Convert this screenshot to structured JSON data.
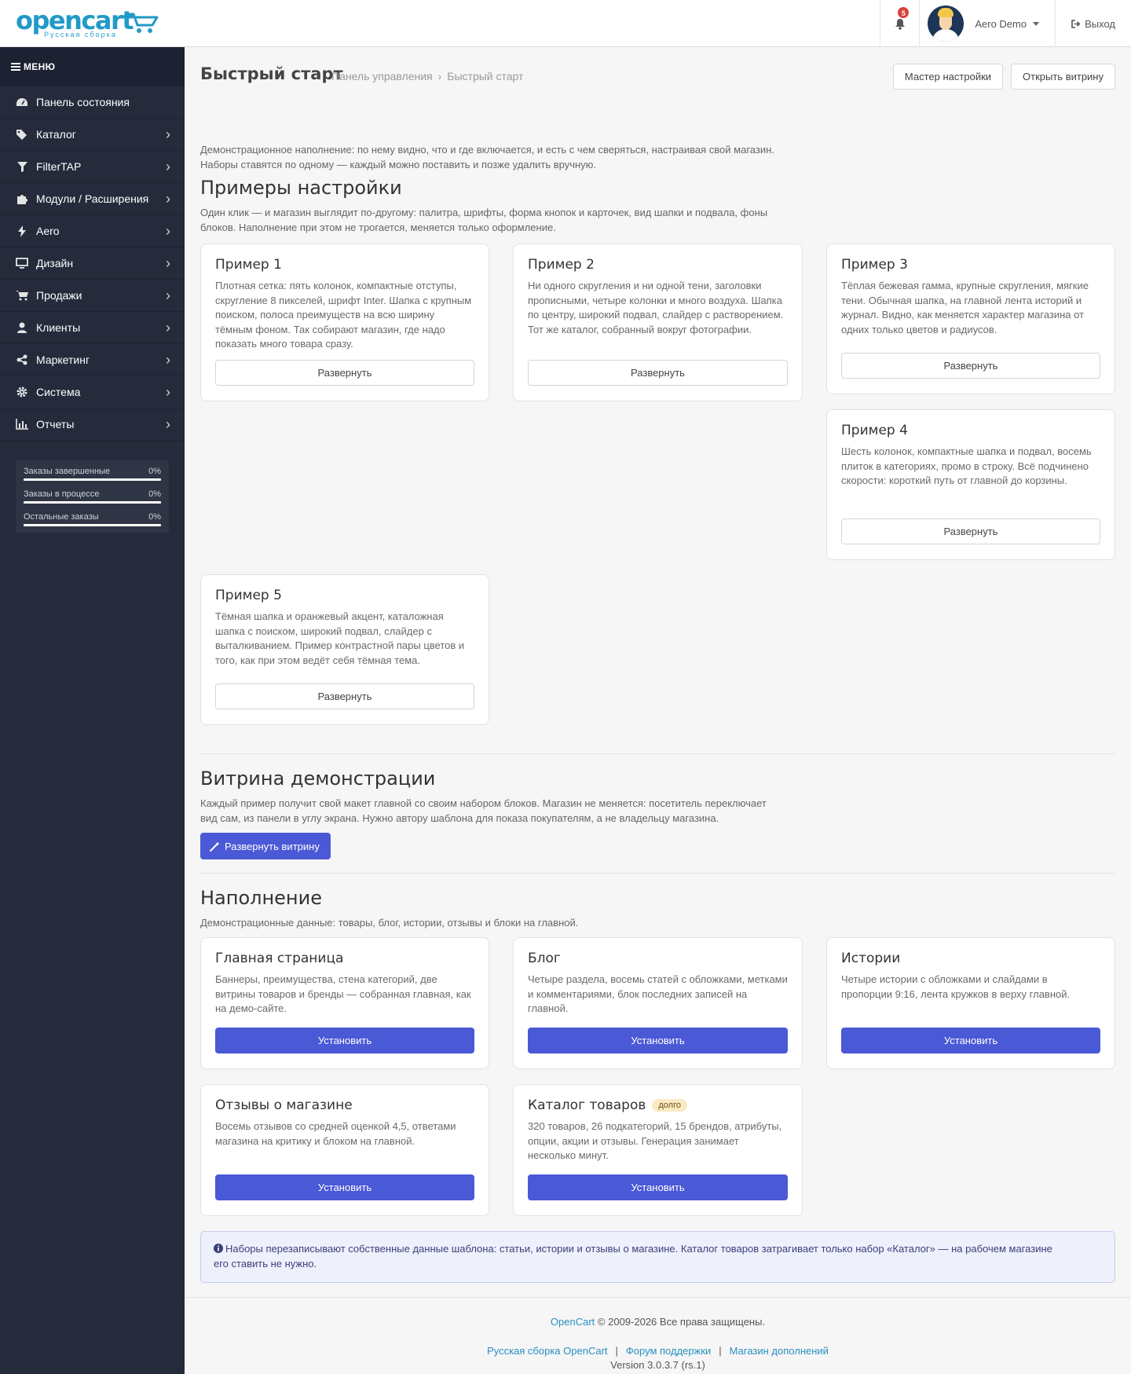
{
  "logo": {
    "main": "opencart",
    "sub": "Русская сборка"
  },
  "header": {
    "notifications_count": "5",
    "user_name": "Aero Demo",
    "logout_label": "Выход"
  },
  "sidebar": {
    "menu_title": "МЕНЮ",
    "items": [
      {
        "label": "Панель состояния",
        "icon": "dashboard-icon",
        "has_children": false
      },
      {
        "label": "Каталог",
        "icon": "tags-icon",
        "has_children": true
      },
      {
        "label": "FilterTAP",
        "icon": "filter-icon",
        "has_children": true
      },
      {
        "label": "Модули / Расширения",
        "icon": "puzzle-icon",
        "has_children": true
      },
      {
        "label": "Aero",
        "icon": "bolt-icon",
        "has_children": true
      },
      {
        "label": "Дизайн",
        "icon": "monitor-icon",
        "has_children": true
      },
      {
        "label": "Продажи",
        "icon": "cart-icon",
        "has_children": true
      },
      {
        "label": "Клиенты",
        "icon": "user-icon",
        "has_children": true
      },
      {
        "label": "Маркетинг",
        "icon": "share-icon",
        "has_children": true
      },
      {
        "label": "Система",
        "icon": "gear-icon",
        "has_children": true
      },
      {
        "label": "Отчеты",
        "icon": "bar-chart-icon",
        "has_children": true
      }
    ],
    "stats": [
      {
        "label": "Заказы завершенные",
        "value": "0%"
      },
      {
        "label": "Заказы в процессе",
        "value": "0%"
      },
      {
        "label": "Остальные заказы",
        "value": "0%"
      }
    ]
  },
  "page": {
    "title": "Быстрый старт",
    "breadcrumb": [
      "Панель управления",
      "Быстрый старт"
    ],
    "buttons": {
      "wizard": "Мастер настройки",
      "open_store": "Открыть витрину"
    },
    "intro_line1": "Демонстрационное наполнение: по нему видно, что и где включается, и есть с чем сверяться, настраивая свой магазин.",
    "intro_line2": "Наборы ставятся по одному — каждый можно поставить и позже удалить вручную."
  },
  "examples": {
    "title": "Примеры настройки",
    "desc_line1": "Один клик — и магазин выглядит по-другому: палитра, шрифты, форма кнопок и карточек, вид шапки и подвала, фоны",
    "desc_line2": "блоков. Наполнение при этом не трогается, меняется только оформление.",
    "button_label": "Развернуть",
    "items": [
      {
        "title": "Пример 1",
        "text": "Плотная сетка: пять колонок, компактные отступы, скругление 8 пикселей, шрифт Inter. Шапка с крупным поиском, полоса преимуществ на всю ширину тёмным фоном. Так собирают магазин, где надо показать много товара сразу."
      },
      {
        "title": "Пример 2",
        "text": "Ни одного скругления и ни одной тени, заголовки прописными, четыре колонки и много воздуха. Шапка по центру, широкий подвал, слайдер с растворением. Тот же каталог, собранный вокруг фотографии."
      },
      {
        "title": "Пример 3",
        "text": "Тёплая бежевая гамма, крупные скругления, мягкие тени. Обычная шапка, на главной лента историй и журнал. Видно, как меняется характер магазина от одних только цветов и радиусов."
      },
      {
        "title": "Пример 4",
        "text": "Шесть колонок, компактные шапка и подвал, восемь плиток в категориях, промо в строку. Всё подчинено скорости: короткий путь от главной до корзины."
      },
      {
        "title": "Пример 5",
        "text": "Тёмная шапка и оранжевый акцент, каталожная шапка с поиском, широкий подвал, слайдер с выталкиванием. Пример контрастной пары цветов и того, как при этом ведёт себя тёмная тема."
      }
    ]
  },
  "showcase": {
    "title": "Витрина демонстрации",
    "desc_line1": "Каждый пример получит свой макет главной со своим набором блоков. Магазин не меняется: посетитель переключает",
    "desc_line2": "вид сам, из панели в углу экрана. Нужно автору шаблона для показа покупателям, а не владельцу магазина.",
    "button_label": "Развернуть витрину"
  },
  "content_sets": {
    "title": "Наполнение",
    "desc": "Демонстрационные данные: товары, блог, истории, отзывы и блоки на главной.",
    "button_label": "Установить",
    "items": [
      {
        "title": "Главная страница",
        "text": "Баннеры, преимущества, стена категорий, две витрины товаров и бренды — собранная главная, как на демо-сайте."
      },
      {
        "title": "Блог",
        "text": "Четыре раздела, восемь статей с обложками, метками и комментариями, блок последних записей на главной."
      },
      {
        "title": "Истории",
        "text": "Четыре истории с обложками и слайдами в пропорции 9:16, лента кружков в верху главной."
      },
      {
        "title": "Отзывы о магазине",
        "text": "Восемь отзывов со средней оценкой 4,5, ответами магазина на критику и блоком на главной."
      },
      {
        "title": "Каталог товаров",
        "tag": "долго",
        "text": "320 товаров, 26 подкатегорий, 15 брендов, атрибуты, опции, акции и отзывы. Генерация занимает несколько минут."
      }
    ]
  },
  "alert": {
    "line1": "Наборы перезаписывают собственные данные шаблона: статьи, истории и отзывы о магазине. Каталог товаров затрагивает только набор «Каталог» — на рабочем магазине",
    "line2": "его ставить не нужно."
  },
  "footer": {
    "brand_link": "OpenCart",
    "copyright": "© 2009-2026 Все права защищены.",
    "links": [
      "Русская сборка OpenCart",
      "Форум поддержки",
      "Магазин дополнений"
    ],
    "version": "Version 3.0.3.7 (rs.1)"
  },
  "colors": {
    "accent": "#4a59d6",
    "sidebar_bg": "#252b3b",
    "logo": "#229ac8",
    "badge": "#d9413c"
  }
}
